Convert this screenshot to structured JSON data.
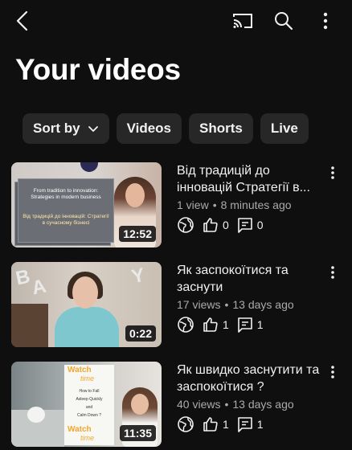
{
  "header": {
    "back_icon": "back-arrow-icon",
    "cast_icon": "cast-icon",
    "search_icon": "search-icon",
    "more_icon": "more-vertical-icon"
  },
  "page_title": "Your videos",
  "filters": {
    "sort_label": "Sort by",
    "chips": [
      "Videos",
      "Shorts",
      "Live"
    ]
  },
  "videos": [
    {
      "title": "Від традицій до інновацій  Стратегії в...",
      "views": "1 view",
      "age": "8 minutes ago",
      "likes": "0",
      "comments": "0",
      "duration": "12:52",
      "thumb_text_en": "From tradition to innovation: Strategies in modern business",
      "thumb_text_ua": "Від традицій до інновацій: Стратегії в сучасному бізнесі"
    },
    {
      "title": "Як заспокоїтися та заснути",
      "views": "17 views",
      "age": "13 days ago",
      "likes": "1",
      "comments": "1",
      "duration": "0:22"
    },
    {
      "title": "Як швидко заснутити та заспокоїтися ?",
      "views": "40 views",
      "age": "13 days ago",
      "likes": "1",
      "comments": "1",
      "duration": "11:35",
      "thumb_watch_top": "Watch",
      "thumb_time_top": "time",
      "thumb_how": "How to Fall",
      "thumb_asleep": "Asleep Quickly",
      "thumb_and": "and",
      "thumb_calm": "Calm Down ?",
      "thumb_watch_bottom": "Watch",
      "thumb_time_bottom": "time"
    }
  ],
  "colors": {
    "background": "#0f0f0f",
    "chip": "#272727",
    "text": "#f1f1f1",
    "secondary": "#aaaaaa"
  }
}
